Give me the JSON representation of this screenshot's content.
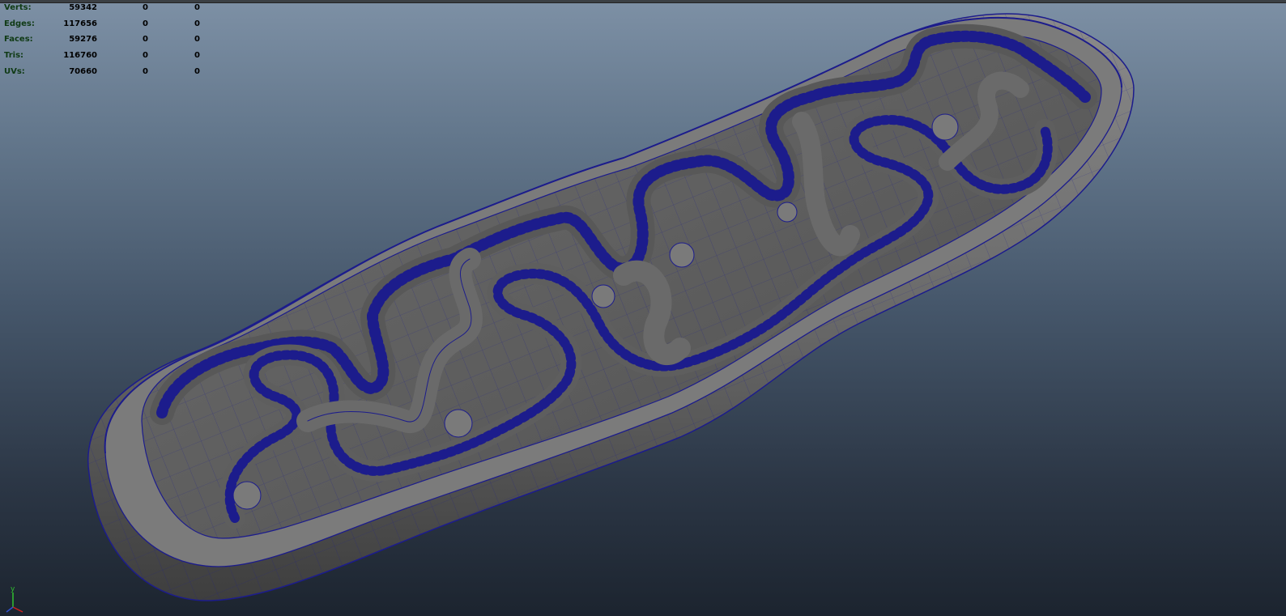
{
  "viewport": {
    "heads_up_display": {
      "rows": [
        {
          "label": "Verts:",
          "values": [
            "59342",
            "0",
            "0"
          ]
        },
        {
          "label": "Edges:",
          "values": [
            "117656",
            "0",
            "0"
          ]
        },
        {
          "label": "Faces:",
          "values": [
            "59276",
            "0",
            "0"
          ]
        },
        {
          "label": "Tris:",
          "values": [
            "116760",
            "0",
            "0"
          ]
        },
        {
          "label": "UVs:",
          "values": [
            "70660",
            "0",
            "0"
          ]
        }
      ]
    },
    "axis_gizmo": {
      "label": "y"
    },
    "colors": {
      "background_top": "#7d90a5",
      "background_bottom": "#1c242f",
      "mesh_shaded": "#707070",
      "wireframe": "#1c1c8c",
      "hud_label": "#0f3a14",
      "axis_x": "#cc2020",
      "axis_y": "#30c030",
      "axis_z": "#3050d0"
    }
  }
}
